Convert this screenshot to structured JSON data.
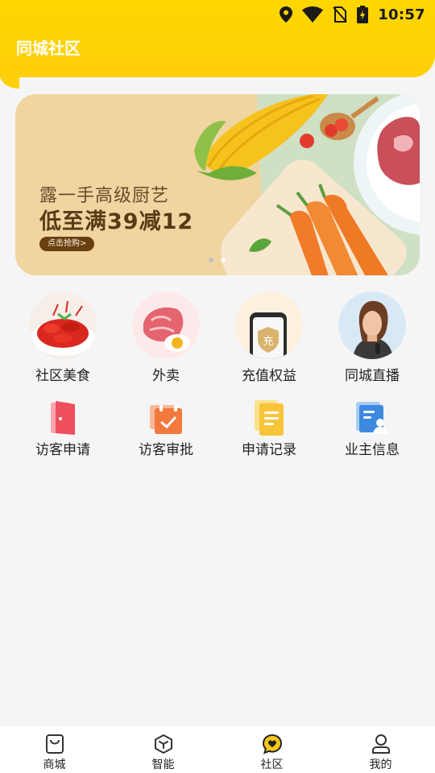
{
  "status_bar": {
    "time": "10:57",
    "icons": [
      "location-icon",
      "wifi-icon",
      "no-sim-icon",
      "battery-charging-icon"
    ]
  },
  "header": {
    "title": "同城社区"
  },
  "banner": {
    "headline": "露一手高级厨艺",
    "offer": "低至满39减12",
    "cta": "点击抢购>",
    "page_count": 2,
    "current_page": 1
  },
  "services": [
    {
      "label": "社区美食",
      "icon": "crayfish-dish-image"
    },
    {
      "label": "外卖",
      "icon": "meat-and-egg-image"
    },
    {
      "label": "充值权益",
      "icon": "recharge-phone-image",
      "badge": "充"
    },
    {
      "label": "同城直播",
      "icon": "live-streamer-avatar"
    }
  ],
  "tools": [
    {
      "label": "访客申请",
      "icon": "door-icon"
    },
    {
      "label": "访客审批",
      "icon": "calendar-check-icon"
    },
    {
      "label": "申请记录",
      "icon": "document-list-icon"
    },
    {
      "label": "业主信息",
      "icon": "owner-profile-icon"
    }
  ],
  "bottom_nav": [
    {
      "label": "商城",
      "icon": "shopping-bag-icon",
      "active": false
    },
    {
      "label": "智能",
      "icon": "cube-icon",
      "active": false
    },
    {
      "label": "社区",
      "icon": "heart-chat-icon",
      "active": true
    },
    {
      "label": "我的",
      "icon": "user-icon",
      "active": false
    }
  ],
  "colors": {
    "header": "#ffd600",
    "accent": "#f5c518",
    "text": "#222222",
    "background": "#f5f5f5"
  }
}
